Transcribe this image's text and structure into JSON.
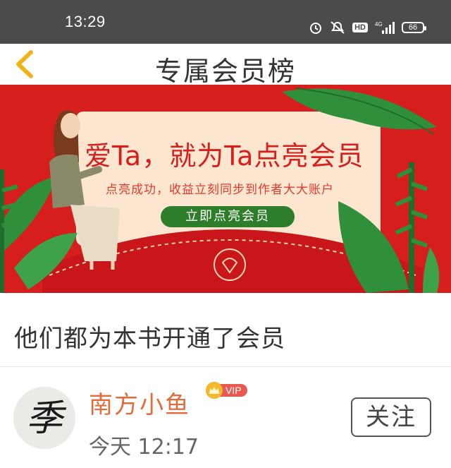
{
  "status_bar": {
    "time": "13:29",
    "network": "4G",
    "hd": "HD",
    "battery": "66",
    "icons": [
      "alarm-icon",
      "mute-icon",
      "hd-icon",
      "signal-icon",
      "battery-icon"
    ]
  },
  "header": {
    "title": "专属会员榜",
    "back_icon": "chevron-left-icon",
    "accent": "#f0b318"
  },
  "banner": {
    "headline": "爱Ta，就为Ta点亮会员",
    "subtitle": "点亮成功，收益立刻同步到作者大大账户",
    "button_label": "立即点亮会员",
    "background": "#d61f1d"
  },
  "section": {
    "title": "他们都为本书开通了会员"
  },
  "members": [
    {
      "name": "南方小鱼",
      "badge": "VIP",
      "time": "今天 12:17",
      "follow_label": "关注",
      "avatar_char": "季"
    }
  ]
}
